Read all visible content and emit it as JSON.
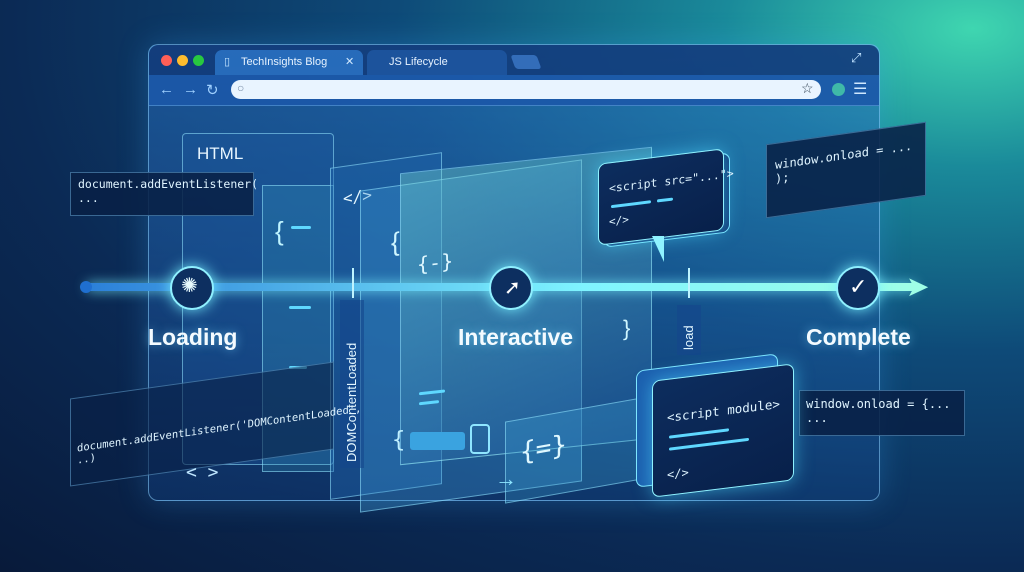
{
  "browser": {
    "tabs": [
      {
        "label": "TechInsights Blog",
        "active": true
      },
      {
        "label": "JS Lifecycle",
        "active": false
      }
    ],
    "url": ""
  },
  "panels": {
    "html_label": "HTML",
    "tag_glyph": "</>",
    "brace_glyph": "{",
    "brace_small": "{-}",
    "brace_close": "}",
    "brace_pair": "{=}",
    "bottom_braces": "{     }"
  },
  "timeline": {
    "stages": [
      {
        "label": "Loading",
        "icon": "spinner-icon"
      },
      {
        "label": "Interactive",
        "icon": "cursor-icon"
      },
      {
        "label": "Complete",
        "icon": "check-icon"
      }
    ],
    "events": [
      "DOMContentLoaded",
      "load"
    ]
  },
  "code_snippets": {
    "listener_top": "document.addEventListener(\n...",
    "listener_dcl": "document.addEventListener('DOMContentLoaded',\n..)",
    "onload_top": "window.onload = ...\n);",
    "onload_bottom": "window.onload = {...\n...",
    "script_src": "<script src=\"...\">",
    "script_src_close": "</>",
    "script_module": "<script module>",
    "script_module_close": "</>",
    "angle": "< >"
  },
  "colors": {
    "accent": "#5fe6ff",
    "timeline": "#5fd8ff",
    "bg": "#0b2a55"
  }
}
